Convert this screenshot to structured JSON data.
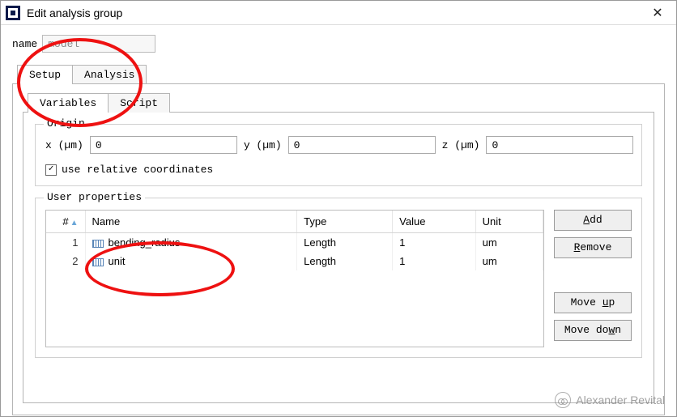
{
  "window": {
    "title": "Edit analysis group",
    "close_glyph": "✕"
  },
  "name_field": {
    "label": "name",
    "value": "model"
  },
  "outer_tabs": {
    "setup": "Setup",
    "analysis": "Analysis"
  },
  "inner_tabs": {
    "variables": "Variables",
    "script": "Script"
  },
  "origin": {
    "legend": "Origin",
    "x_label": "x (µm)",
    "y_label": "y (µm)",
    "z_label": "z (µm)",
    "x_value": "0",
    "y_value": "0",
    "z_value": "0",
    "checkbox_label": "use relative coordinates",
    "checkbox_mark": "✓"
  },
  "user_props": {
    "legend": "User properties",
    "headers": {
      "num": "#",
      "name": "Name",
      "type": "Type",
      "value": "Value",
      "unit": "Unit"
    },
    "rows": [
      {
        "num": "1",
        "name": "bending_radius",
        "type": "Length",
        "value": "1",
        "unit": "um"
      },
      {
        "num": "2",
        "name": "unit",
        "type": "Length",
        "value": "1",
        "unit": "um"
      }
    ],
    "buttons": {
      "add": {
        "pre": "",
        "u": "A",
        "post": "dd"
      },
      "remove": {
        "pre": "",
        "u": "R",
        "post": "emove"
      },
      "moveup": {
        "pre": "Move ",
        "u": "u",
        "post": "p"
      },
      "movedn": {
        "pre": "Move do",
        "u": "w",
        "post": "n"
      }
    }
  },
  "watermark": "Alexander Revital"
}
